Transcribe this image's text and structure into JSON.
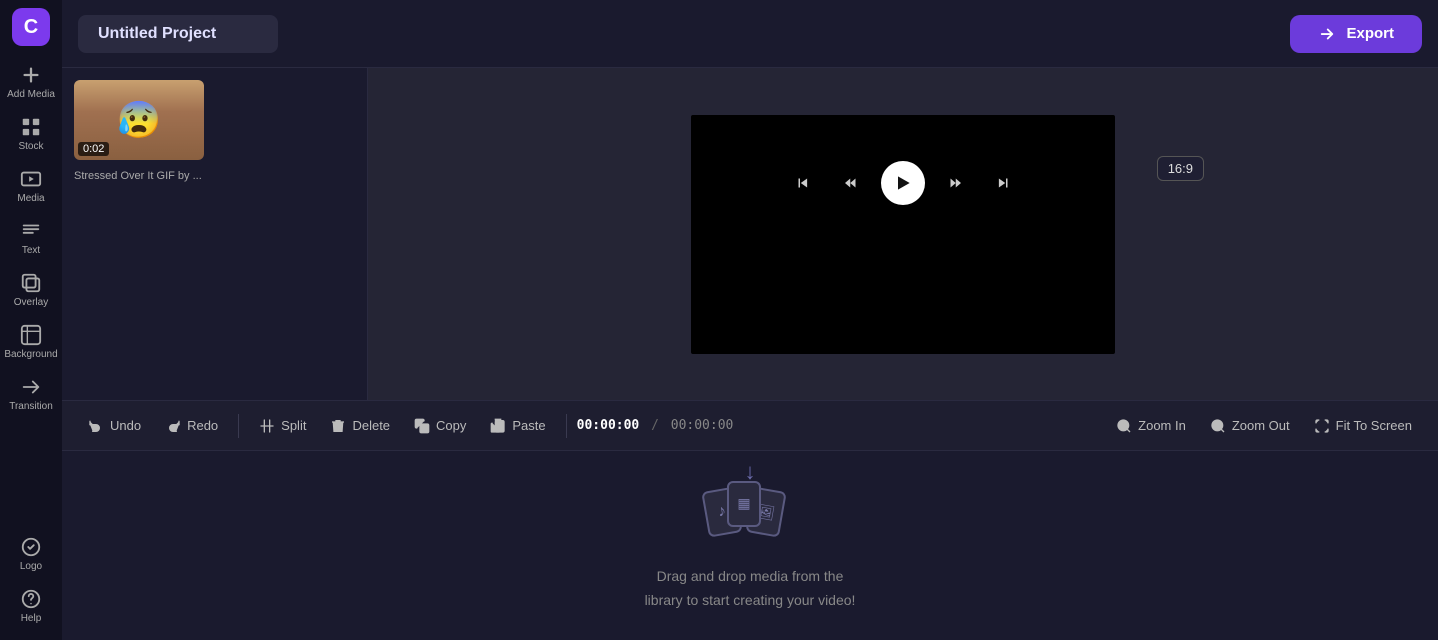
{
  "sidebar": {
    "logo_letter": "C",
    "items": [
      {
        "id": "add-media",
        "label": "Add Media",
        "icon": "plus"
      },
      {
        "id": "stock",
        "label": "Stock",
        "icon": "stock"
      },
      {
        "id": "media",
        "label": "Media",
        "icon": "media"
      },
      {
        "id": "text",
        "label": "Text",
        "icon": "text"
      },
      {
        "id": "overlay",
        "label": "Overlay",
        "icon": "overlay"
      },
      {
        "id": "background",
        "label": "Background",
        "icon": "background"
      },
      {
        "id": "transition",
        "label": "Transition",
        "icon": "transition"
      },
      {
        "id": "logo",
        "label": "Logo",
        "icon": "logo"
      },
      {
        "id": "help",
        "label": "Help",
        "icon": "help"
      }
    ]
  },
  "topbar": {
    "project_title": "Untitled Project",
    "export_label": "Export",
    "aspect_ratio": "16:9"
  },
  "media_panel": {
    "items": [
      {
        "id": "stressed-gif",
        "duration": "0:02",
        "label": "Stressed Over It GIF by ..."
      }
    ]
  },
  "toolbar": {
    "undo_label": "Undo",
    "redo_label": "Redo",
    "split_label": "Split",
    "delete_label": "Delete",
    "copy_label": "Copy",
    "paste_label": "Paste",
    "timecode_current": "00:00:00",
    "timecode_divider": "/",
    "timecode_total": "00:00:00",
    "zoom_in_label": "Zoom In",
    "zoom_out_label": "Zoom Out",
    "fit_to_screen_label": "Fit To Screen"
  },
  "timeline": {
    "empty_message_line1": "Drag and drop media from the",
    "empty_message_line2": "library to start creating your video!"
  },
  "colors": {
    "accent": "#7c3aed",
    "bg_dark": "#111120",
    "bg_mid": "#1a1a2e",
    "bg_light": "#252535"
  }
}
